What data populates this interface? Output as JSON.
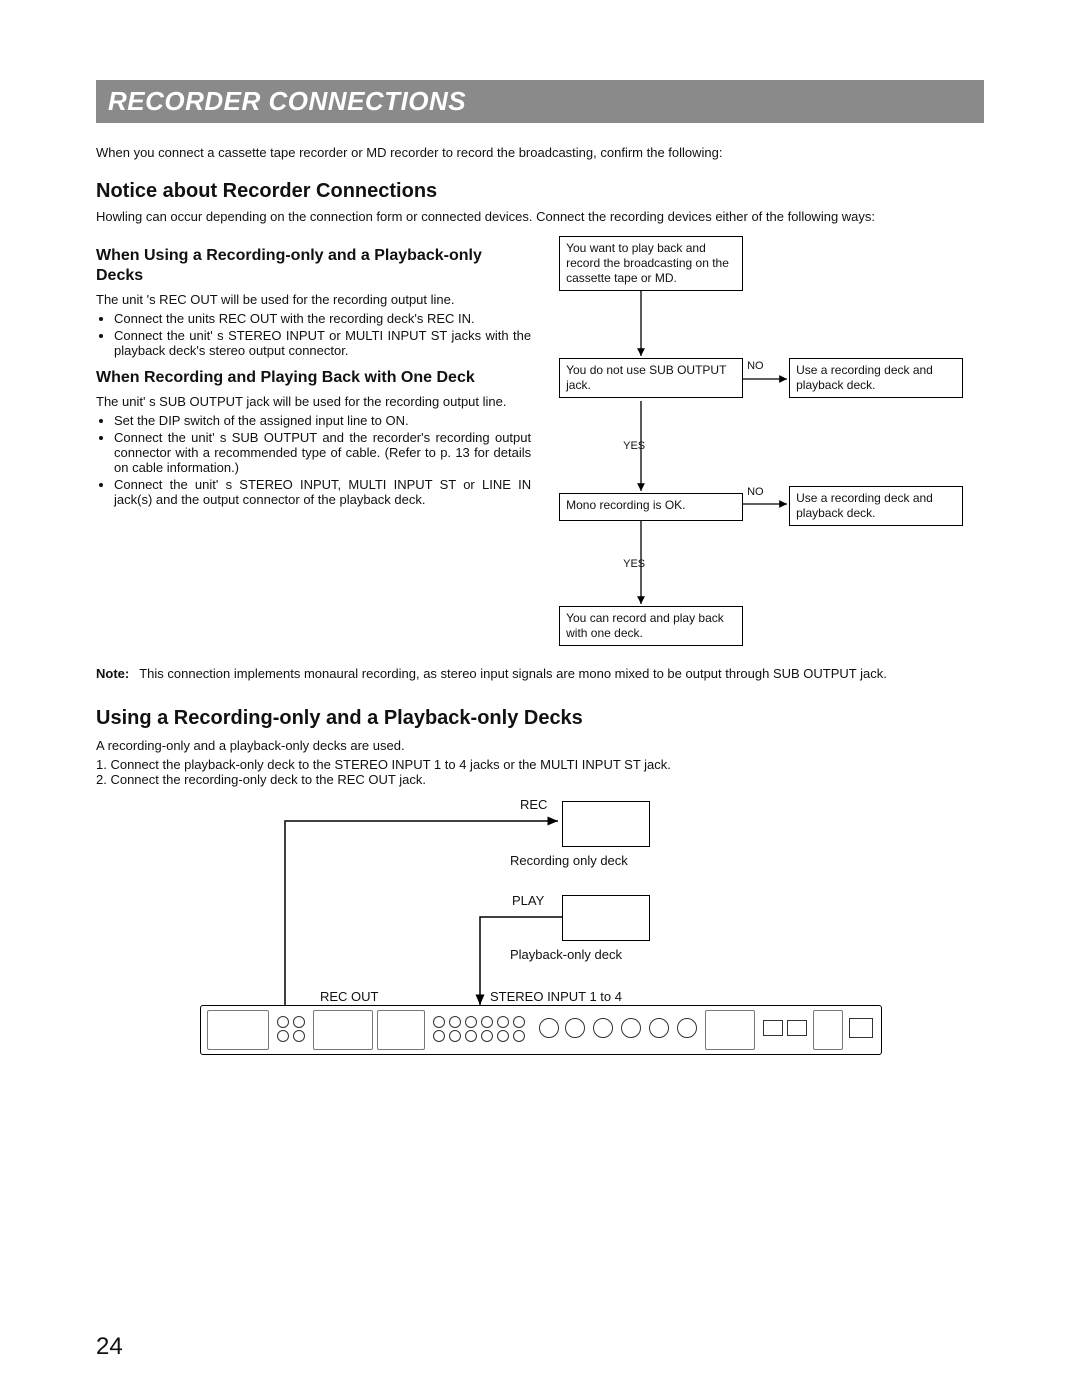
{
  "banner": "RECORDER CONNECTIONS",
  "intro": "When you connect a cassette tape recorder or MD recorder to record the broadcasting, confirm the following:",
  "s1": {
    "title": "Notice about Recorder Connections",
    "lede": "Howling can occur depending on the connection form or connected devices. Connect the recording devices either of the following ways:",
    "left": {
      "h3a": "When Using a Recording-only and a Playback-only Decks",
      "pa": "The unit 's REC OUT will be used for the recording output line.",
      "ba": [
        "Connect the units REC OUT with the recording deck's REC IN.",
        "Connect the unit' s STEREO INPUT or MULTI INPUT ST jacks with the playback deck's stereo output connector."
      ],
      "h3b": "When Recording and Playing Back with One Deck",
      "pb": "The unit' s SUB OUTPUT jack will be used for the recording output line.",
      "bb": [
        "Set the DIP switch of the assigned input line to ON.",
        "Connect the unit' s SUB OUTPUT and the recorder's recording output connector with a recommended type of cable. (Refer to p. 13 for details on cable information.)",
        "Connect the unit' s STEREO INPUT, MULTI INPUT ST or LINE IN jack(s) and the output connector of the playback deck."
      ]
    },
    "note_label": "Note:",
    "note": "This connection implements monaural recording, as stereo input signals are mono mixed to be output through SUB OUTPUT jack."
  },
  "flow": {
    "start": "You want to play back and record the broadcasting on the cassette tape or MD.",
    "q1": "You do not use SUB OUTPUT jack.",
    "a1_right": "Use a recording deck and playback deck.",
    "q2": "Mono recording is OK.",
    "a2_right": "Use a recording deck and playback deck.",
    "end": "You can record and play back with one deck.",
    "yes": "YES",
    "no": "NO"
  },
  "s2": {
    "title": "Using a Recording-only and a Playback-only Decks",
    "p0": "A recording-only and a playback-only decks are used.",
    "steps": [
      "1. Connect the playback-only deck to the STEREO INPUT 1 to 4 jacks or the MULTI INPUT ST jack.",
      "2. Connect the recording-only deck to the REC OUT jack."
    ],
    "labels": {
      "rec": "REC",
      "play": "PLAY",
      "recdeck": "Recording only deck",
      "playdeck": "Playback-only deck",
      "recout": "REC OUT",
      "stin": "STEREO INPUT 1 to 4"
    }
  },
  "page_number": "24"
}
